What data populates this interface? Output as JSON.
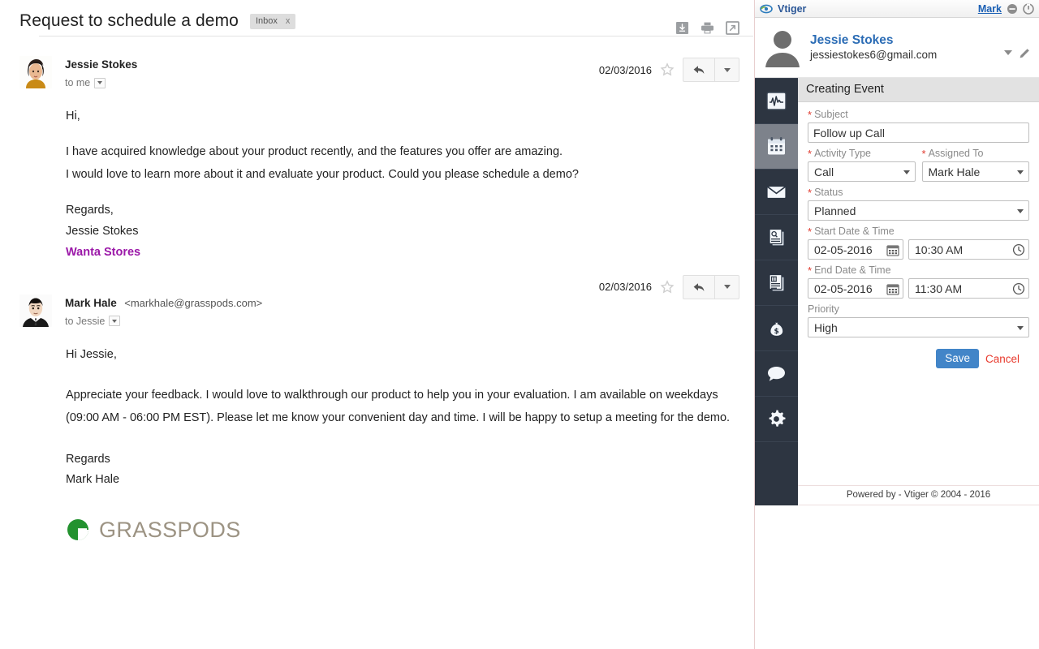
{
  "email": {
    "subject": "Request to schedule a demo",
    "label": {
      "name": "Inbox",
      "close": "x"
    },
    "tools": [
      {
        "name": "download-icon",
        "title": "Download"
      },
      {
        "name": "print-icon",
        "title": "Print"
      },
      {
        "name": "popout-icon",
        "title": "Open in new window"
      }
    ],
    "messages": [
      {
        "sender_name": "Jessie Stokes",
        "sender_email": "",
        "recipient": "to me",
        "date": "02/03/2016",
        "avatar": "woman-avatar",
        "body": [
          "Hi,",
          "I have acquired knowledge about your product recently, and the features you offer are amazing.",
          "I would love to learn more about it and evaluate your product. Could you please schedule a demo?"
        ],
        "signature": {
          "lines": [
            "Regards,",
            "Jessie Stokes"
          ],
          "company": "Wanta Stores"
        }
      },
      {
        "sender_name": "Mark Hale",
        "sender_email": "<markhale@grasspods.com>",
        "recipient": "to Jessie",
        "date": "02/03/2016",
        "avatar": "man-avatar",
        "body": [
          "Hi Jessie,",
          "Appreciate your feedback. I would love to walkthrough our product to help you in your evaluation. I am available on weekdays (09:00 AM - 06:00 PM EST). Please let me know your convenient day and time. I will be happy to setup a meeting for the demo."
        ],
        "signature": {
          "lines": [
            "Regards",
            "Mark Hale"
          ],
          "logo_text": "GRASSPODS"
        }
      }
    ]
  },
  "vtiger": {
    "titlebar": {
      "app_name": "Vtiger",
      "user": "Mark",
      "minimize": "minimize-icon",
      "power": "power-icon"
    },
    "contact": {
      "name": "Jessie Stokes",
      "email": "jessiestokes6@gmail.com"
    },
    "rail": [
      {
        "name": "analytics-icon",
        "label": "Analytics",
        "active": false
      },
      {
        "name": "calendar-icon",
        "label": "Calendar",
        "active": true
      },
      {
        "name": "mail-icon",
        "label": "Mail",
        "active": false
      },
      {
        "name": "contacts-icon",
        "label": "Contacts",
        "active": false
      },
      {
        "name": "documents-icon",
        "label": "Documents",
        "active": false
      },
      {
        "name": "money-bag-icon",
        "label": "Deals",
        "active": false
      },
      {
        "name": "chat-icon",
        "label": "Comments",
        "active": false
      },
      {
        "name": "gear-icon",
        "label": "Settings",
        "active": false
      }
    ],
    "form": {
      "title": "Creating Event",
      "subject": {
        "label": "Subject",
        "value": "Follow up Call",
        "required": true
      },
      "activity_type": {
        "label": "Activity Type",
        "value": "Call",
        "required": true
      },
      "assigned_to": {
        "label": "Assigned To",
        "value": "Mark Hale",
        "required": true
      },
      "status": {
        "label": "Status",
        "value": "Planned",
        "required": true
      },
      "start": {
        "label": "Start Date & Time",
        "date": "02-05-2016",
        "time": "10:30 AM",
        "required": true
      },
      "end": {
        "label": "End Date & Time",
        "date": "02-05-2016",
        "time": "11:30 AM",
        "required": true
      },
      "priority": {
        "label": "Priority",
        "value": "High",
        "required": false
      },
      "save_label": "Save",
      "cancel_label": "Cancel"
    },
    "footer": "Powered by - Vtiger © 2004 - 2016"
  },
  "colors": {
    "vtiger_blue": "#2b5797",
    "contact_blue": "#2b6cb5",
    "save_blue": "#4285c8",
    "cancel_red": "#e8392c",
    "required_red": "#e03a2f",
    "rail_dark": "#2d3541",
    "rail_active": "#7d828b",
    "company_purple": "#9b18a8",
    "logo_green": "#23922f",
    "logo_taupe": "#9c9383"
  }
}
